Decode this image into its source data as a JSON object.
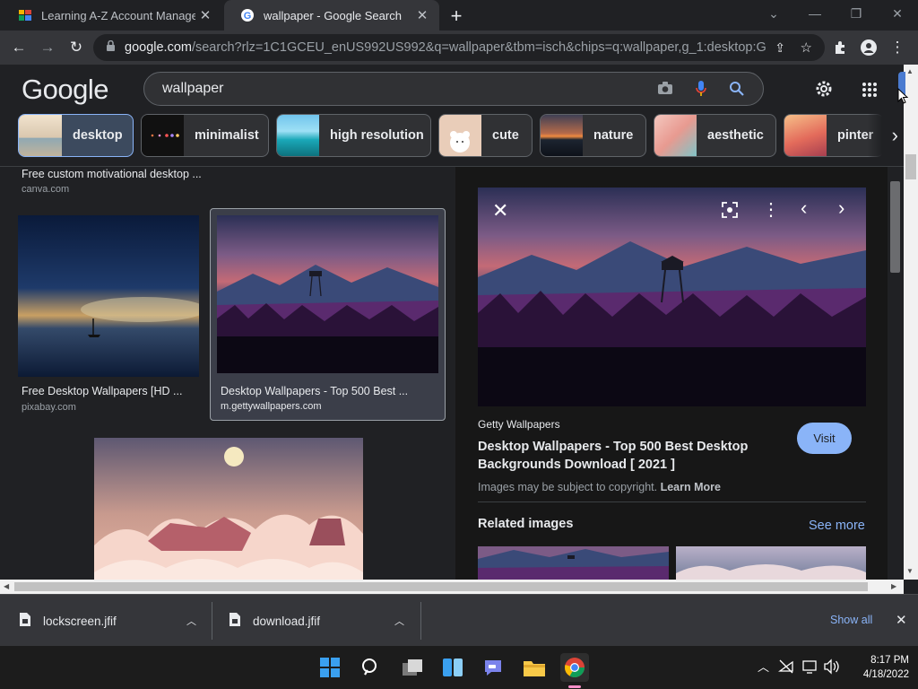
{
  "tabs": [
    {
      "title": "Learning A-Z Account Manageme",
      "close": "✕"
    },
    {
      "title": "wallpaper - Google Search",
      "close": "✕"
    }
  ],
  "newtab": "+",
  "address": {
    "domain": "google.com",
    "path": "/search?rlz=1C1GCEU_enUS992US992&q=wallpaper&tbm=isch&chips=q:wallpaper,g_1:desktop:Gh..."
  },
  "google": {
    "logo": "Google",
    "query": "wallpaper",
    "chips": [
      {
        "label": "desktop"
      },
      {
        "label": "minimalist"
      },
      {
        "label": "high resolution"
      },
      {
        "label": "cute"
      },
      {
        "label": "nature"
      },
      {
        "label": "aesthetic"
      },
      {
        "label": "pinter"
      }
    ]
  },
  "results": [
    {
      "caption": "Free custom motivational desktop ...",
      "source": "canva.com"
    },
    {
      "caption": "Free Desktop Wallpapers [HD ...",
      "source": "pixabay.com"
    },
    {
      "caption": "Desktop Wallpapers - Top 500 Best ...",
      "source": "m.gettywallpapers.com"
    }
  ],
  "preview": {
    "source": "Getty Wallpapers",
    "title": "Desktop Wallpapers - Top 500 Best Desktop Backgrounds Download [ 2021 ]",
    "visit": "Visit",
    "copyright": "Images may be subject to copyright.",
    "learn_more": "Learn More",
    "related": "Related images",
    "see_more": "See more"
  },
  "downloads": {
    "items": [
      {
        "name": "lockscreen.jfif"
      },
      {
        "name": "download.jfif"
      }
    ],
    "show_all": "Show all"
  },
  "taskbar": {
    "time": "8:17 PM",
    "date": "4/18/2022"
  },
  "colors": {
    "accent": "#8ab4f8",
    "visit_button": "#8ab4f8",
    "background": "#202124"
  }
}
